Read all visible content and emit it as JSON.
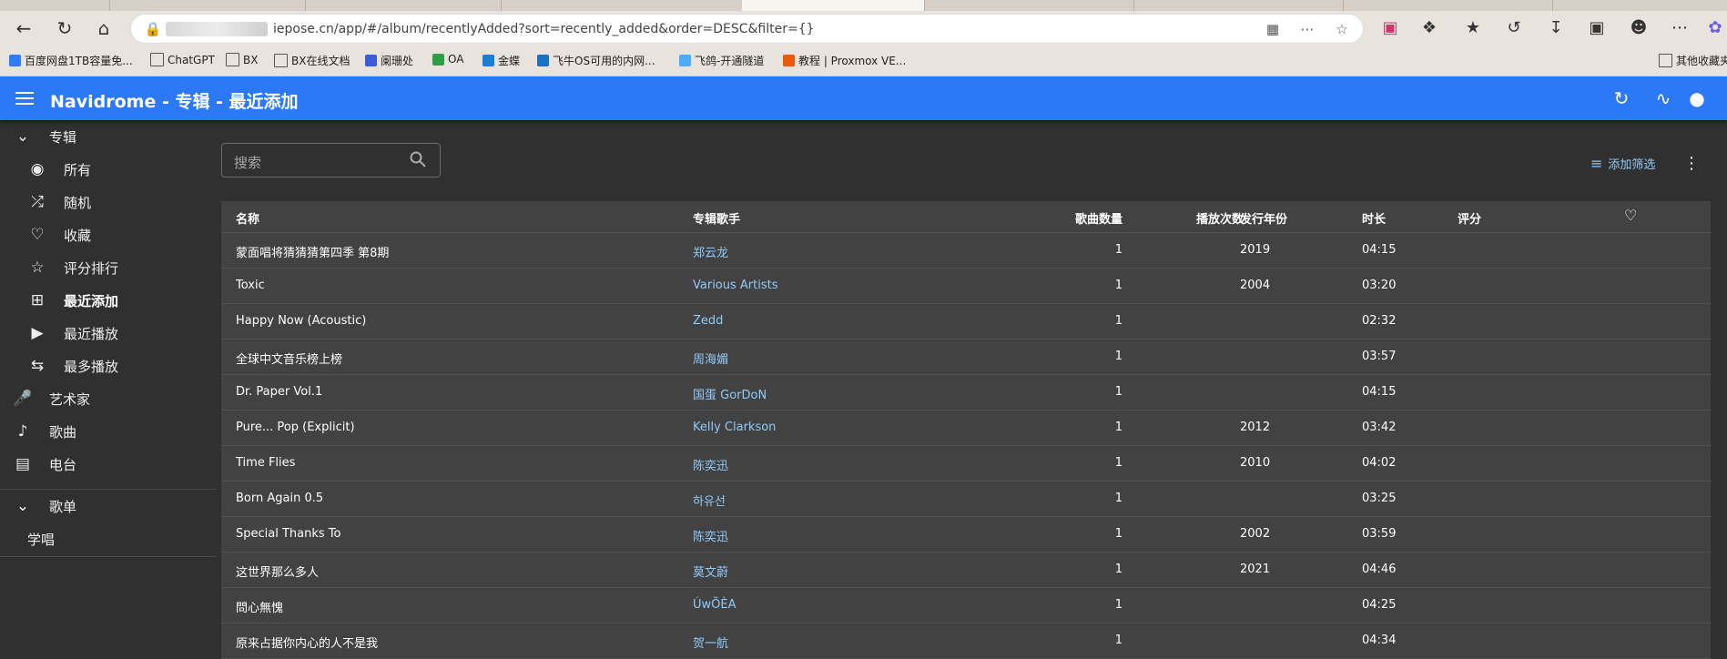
{
  "browser": {
    "url": "iepose.cn/app/#/album/recentlyAdded?sort=recently_added&order=DESC&filter={}",
    "bookmarks": [
      {
        "label": "百度网盘1TB容量免...",
        "color": "#2f7cf6"
      },
      {
        "label": "ChatGPT",
        "color": "folder"
      },
      {
        "label": "BX",
        "color": "folder"
      },
      {
        "label": "BX在线文档",
        "color": "folder"
      },
      {
        "label": "阑珊处",
        "color": "#3b5bdb"
      },
      {
        "label": "OA",
        "color": "#2f9e44"
      },
      {
        "label": "金蝶",
        "color": "#1c7ed6"
      },
      {
        "label": "飞牛OS可用的内网...",
        "color": "#1971c2"
      },
      {
        "label": "飞鸽-开通隧道",
        "color": "#4dabf7"
      },
      {
        "label": "教程 | Proxmox VE...",
        "color": "#e8590c"
      },
      {
        "label": "其他收藏夹",
        "color": "folder"
      }
    ]
  },
  "appbar": {
    "title": "Navidrome - 专辑 - 最近添加"
  },
  "sidebar": {
    "sections": [
      {
        "label": "专辑",
        "icon": "chevron-down-icon"
      },
      {
        "label": "艺术家",
        "icon": "microphone-icon"
      },
      {
        "label": "歌曲",
        "icon": "music-note-icon"
      },
      {
        "label": "电台",
        "icon": "radio-icon"
      },
      {
        "label": "歌单",
        "icon": "chevron-down-icon"
      }
    ],
    "album_items": [
      {
        "label": "所有",
        "icon": "album-icon"
      },
      {
        "label": "随机",
        "icon": "shuffle-icon"
      },
      {
        "label": "收藏",
        "icon": "heart-icon"
      },
      {
        "label": "评分排行",
        "icon": "star-icon"
      },
      {
        "label": "最近添加",
        "icon": "library-add-icon",
        "active": true
      },
      {
        "label": "最近播放",
        "icon": "video-library-icon"
      },
      {
        "label": "最多播放",
        "icon": "repeat-icon"
      }
    ],
    "playlists": [
      "学唱"
    ]
  },
  "toolbar": {
    "search_placeholder": "搜索",
    "filter_label": "添加筛选"
  },
  "table": {
    "columns": {
      "name": "名称",
      "artist": "专辑歌手",
      "songs": "歌曲数量",
      "plays": "播放次数",
      "year": "发行年份",
      "duration": "时长",
      "rating": "评分"
    },
    "rows": [
      {
        "name": "蒙面唱将猜猜猜第四季 第8期",
        "artist": "郑云龙",
        "songs": "1",
        "plays": "",
        "year": "2019",
        "duration": "04:15"
      },
      {
        "name": "Toxic",
        "artist": "Various Artists",
        "songs": "1",
        "plays": "",
        "year": "2004",
        "duration": "03:20"
      },
      {
        "name": "Happy Now (Acoustic)",
        "artist": "Zedd",
        "songs": "1",
        "plays": "",
        "year": "",
        "duration": "02:32"
      },
      {
        "name": "全球中文音乐榜上榜",
        "artist": "周海媚",
        "songs": "1",
        "plays": "",
        "year": "",
        "duration": "03:57"
      },
      {
        "name": "Dr. Paper Vol.1",
        "artist": "国蛋 GorDoN",
        "songs": "1",
        "plays": "",
        "year": "",
        "duration": "04:15"
      },
      {
        "name": "Pure... Pop (Explicit)",
        "artist": "Kelly Clarkson",
        "songs": "1",
        "plays": "",
        "year": "2012",
        "duration": "03:42"
      },
      {
        "name": "Time Flies",
        "artist": "陈奕迅",
        "songs": "1",
        "plays": "",
        "year": "2010",
        "duration": "04:02"
      },
      {
        "name": "Born Again 0.5",
        "artist": "하유선",
        "songs": "1",
        "plays": "",
        "year": "",
        "duration": "03:25"
      },
      {
        "name": "Special Thanks To",
        "artist": "陈奕迅",
        "songs": "1",
        "plays": "",
        "year": "2002",
        "duration": "03:59"
      },
      {
        "name": "这世界那么多人",
        "artist": "莫文蔚",
        "songs": "1",
        "plays": "",
        "year": "2021",
        "duration": "04:46"
      },
      {
        "name": "問心無愧",
        "artist": "ÚwÕÈA",
        "songs": "1",
        "plays": "",
        "year": "",
        "duration": "04:25"
      },
      {
        "name": "原来占据你内心的人不是我",
        "artist": "贺一航",
        "songs": "1",
        "plays": "",
        "year": "",
        "duration": "04:34"
      }
    ]
  },
  "colors": {
    "appbar": "#2b79f6",
    "background": "#303030",
    "table": "#424242",
    "link": "#90caf9"
  }
}
